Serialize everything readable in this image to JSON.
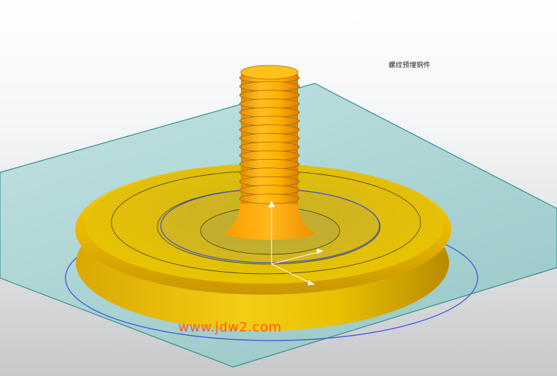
{
  "annotation": {
    "text": "螺纹预埋铜件"
  },
  "watermark": {
    "text": "www.jdw2.com"
  },
  "colors": {
    "background_top": "#ffffff",
    "background_bottom": "#c6c8ca",
    "datum_plane_fill": "#9ecfcf",
    "datum_plane_edge": "#2d8c8c",
    "part_yellow": "#f2c200",
    "part_orange": "#ffa200",
    "sketch_blue": "#3a55e0",
    "watermark": "#ff5a1e"
  },
  "icons": [
    "datum-csys-icon"
  ]
}
